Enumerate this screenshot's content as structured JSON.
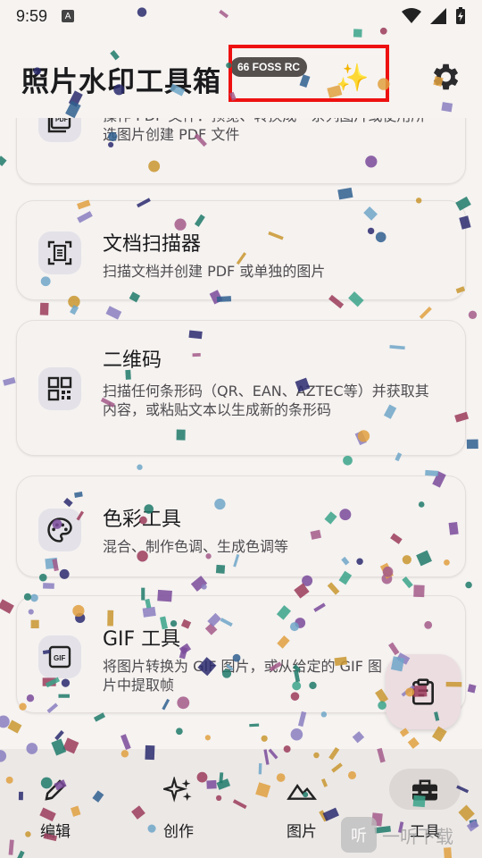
{
  "status_bar": {
    "time": "9:59",
    "badge": "A"
  },
  "app_bar": {
    "title": "照片水印工具箱",
    "version_pill": "66 FOSS RC",
    "sparkle_icon": "sparkles-icon",
    "settings_icon": "gear-icon",
    "highlight_color": "#ee1111"
  },
  "tools": [
    {
      "title": "",
      "desc": "操作 PDF 文件：预览、转换成一系列图片或使用所选图片创建 PDF 文件",
      "icon": "pdf-icon"
    },
    {
      "title": "文档扫描器",
      "desc": "扫描文档并创建 PDF 或单独的图片",
      "icon": "document-scanner-icon"
    },
    {
      "title": "二维码",
      "desc": "扫描任何条形码（QR、EAN、AZTEC等）并获取其内容，或粘贴文本以生成新的条形码",
      "icon": "qr-code-icon"
    },
    {
      "title": "色彩工具",
      "desc": "混合、制作色调、生成色调等",
      "icon": "palette-icon"
    },
    {
      "title": "GIF 工具",
      "desc": "将图片转换为 GIF 图片，或从给定的 GIF 图片中提取帧",
      "icon": "gif-icon"
    }
  ],
  "bottom_nav": [
    {
      "label": "编辑",
      "icon": "edit-icon"
    },
    {
      "label": "创作",
      "icon": "create-sparkle-icon"
    },
    {
      "label": "图片",
      "icon": "image-icon"
    },
    {
      "label": "工具",
      "icon": "toolbox-icon",
      "selected": true
    }
  ],
  "fab_icon": "clipboard-icon",
  "watermark": {
    "text": "一听下载",
    "logo": "听"
  },
  "colors": {
    "background": "#f6f3f1",
    "card": "#f5f2f0",
    "icon_box": "#e4e2e8",
    "nav": "#ece8e6",
    "fab": "#ecdde1"
  }
}
